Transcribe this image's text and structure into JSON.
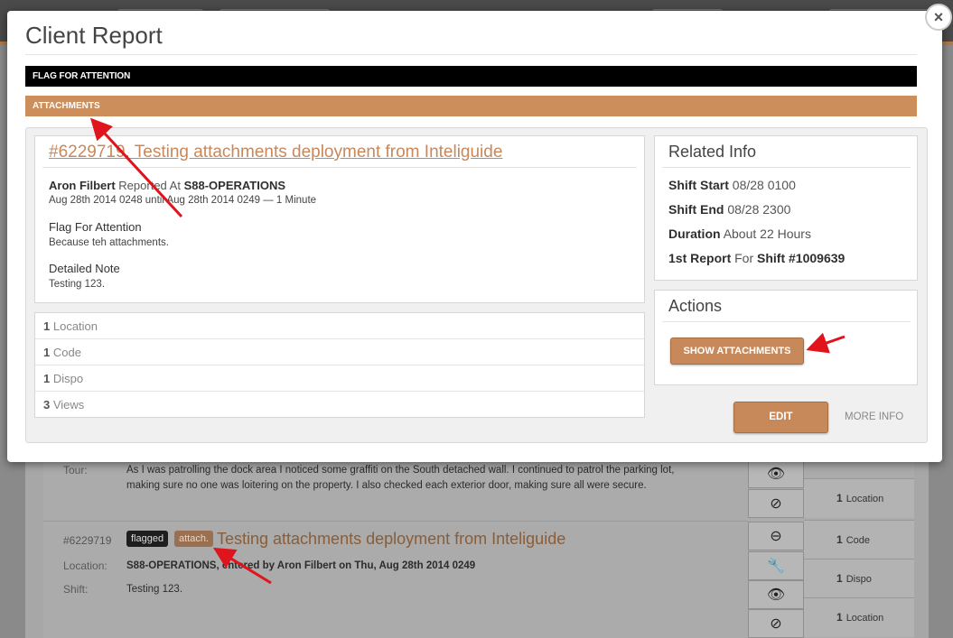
{
  "modal": {
    "title": "Client Report",
    "close_label": "×",
    "flag_bar": "FLAG FOR ATTENTION",
    "attach_bar": "ATTACHMENTS",
    "report": {
      "title": "#6229719. Testing attachments deployment from Inteliguide",
      "reporter": "Aron Filbert",
      "reported_at_label": "Reported At",
      "location": "S88-OPERATIONS",
      "timeframe": "Aug 28th 2014 0248 until Aug 28th 2014 0249 — 1 Minute",
      "flag_heading": "Flag For Attention",
      "flag_text": "Because teh attachments.",
      "note_heading": "Detailed Note",
      "note_text": "Testing 123."
    },
    "stats": [
      {
        "count": "1",
        "label": "Location"
      },
      {
        "count": "1",
        "label": "Code"
      },
      {
        "count": "1",
        "label": "Dispo"
      },
      {
        "count": "3",
        "label": "Views"
      }
    ],
    "related": {
      "heading": "Related Info",
      "shift_start_label": "Shift Start",
      "shift_start": "08/28 0100",
      "shift_end_label": "Shift End",
      "shift_end": "08/28 2300",
      "duration_label": "Duration",
      "duration": "About 22 Hours",
      "first_report_label": "1st Report",
      "for_label": "For",
      "shift_label": "Shift",
      "shift_number": "#1009639"
    },
    "actions": {
      "heading": "Actions",
      "show_attachments": "SHOW ATTACHMENTS"
    },
    "edit_label": "EDIT",
    "more_info_label": "MORE INFO"
  },
  "background": {
    "row1": {
      "label": "Tour:",
      "text": "As I was patrolling the dock area I noticed some graffiti on the South detached wall. I continued to patrol the parking lot, making sure no one was loitering on the property. I also checked each exterior door, making sure all were secure."
    },
    "row2": {
      "id": "#6229719",
      "badge_flagged": "flagged",
      "badge_attach": "attach.",
      "title": "Testing attachments deployment from Inteliguide",
      "location_label": "Location:",
      "location_place": "S88-OPERATIONS",
      "location_rest": ", entered by Aron Filbert on Thu, Aug 28th 2014 0249",
      "shift_label": "Shift:",
      "shift_text": "Testing 123."
    },
    "counts": [
      {
        "count": "1",
        "label": "Location"
      },
      {
        "count": "1",
        "label": "Code"
      },
      {
        "count": "1",
        "label": "Dispo"
      },
      {
        "count": "1",
        "label": "Location"
      }
    ]
  },
  "colors": {
    "accent": "#cc8f5c",
    "flag_bar": "#000000",
    "annotation_arrow": "#e0141c"
  }
}
